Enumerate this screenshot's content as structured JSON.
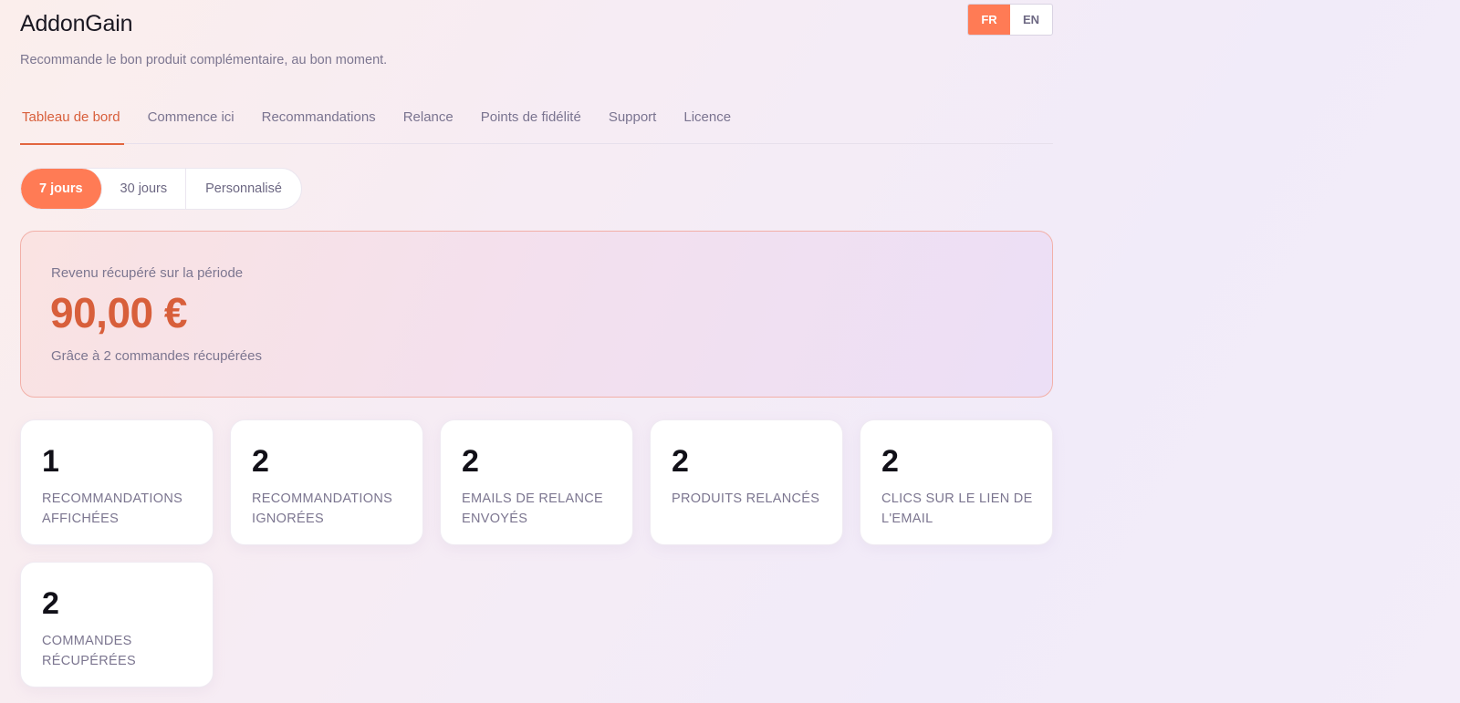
{
  "header": {
    "title": "AddonGain",
    "tagline": "Recommande le bon produit complémentaire, au bon moment."
  },
  "language": {
    "options": [
      "FR",
      "EN"
    ],
    "active": "FR"
  },
  "tabs": [
    {
      "label": "Tableau de bord",
      "active": true
    },
    {
      "label": "Commence ici",
      "active": false
    },
    {
      "label": "Recommandations",
      "active": false
    },
    {
      "label": "Relance",
      "active": false
    },
    {
      "label": "Points de fidélité",
      "active": false
    },
    {
      "label": "Support",
      "active": false
    },
    {
      "label": "Licence",
      "active": false
    }
  ],
  "period": {
    "options": [
      "7 jours",
      "30 jours",
      "Personnalisé"
    ],
    "active": "7 jours"
  },
  "revenue": {
    "label": "Revenu récupéré sur la période",
    "amount": "90,00 €",
    "subtext": "Grâce à 2 commandes récupérées"
  },
  "stats": [
    {
      "value": "1",
      "label": "Recommandations affichées"
    },
    {
      "value": "2",
      "label": "Recommandations ignorées"
    },
    {
      "value": "2",
      "label": "Emails de relance envoyés"
    },
    {
      "value": "2",
      "label": "Produits relancés"
    },
    {
      "value": "2",
      "label": "Clics sur le lien de l'email"
    },
    {
      "value": "2",
      "label": "Commandes récupérées"
    }
  ],
  "colors": {
    "accent": "#ff7b55",
    "accent_text": "#d85f3b",
    "muted_text": "#7c7690"
  }
}
